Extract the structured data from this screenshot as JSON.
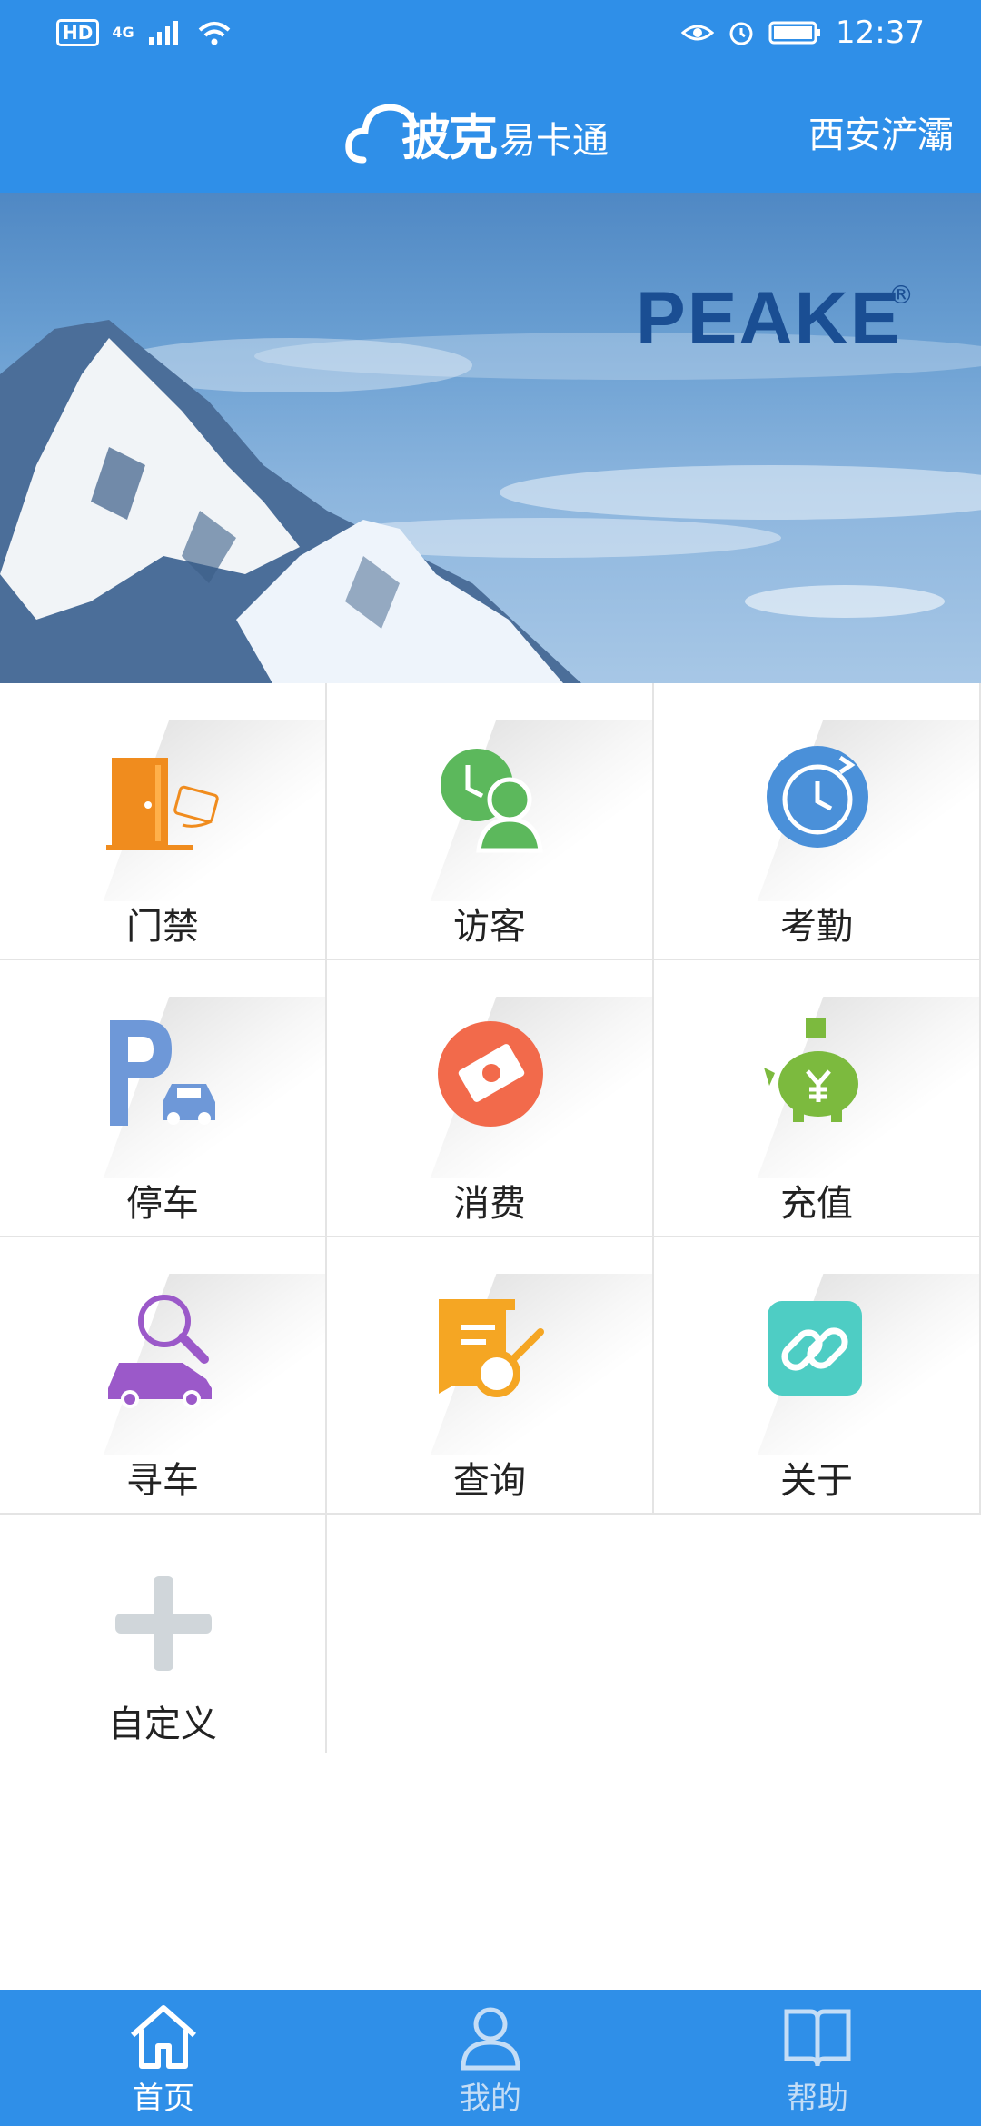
{
  "status_bar": {
    "hd": "HD",
    "network": "4G",
    "time": "12:37"
  },
  "header": {
    "logo_main": "披克",
    "logo_sub": "易卡通",
    "location": "西安浐灞"
  },
  "banner": {
    "brand": "PEAKE",
    "registered": "®"
  },
  "grid": {
    "items": [
      {
        "label": "门禁",
        "icon": "door-card-icon"
      },
      {
        "label": "访客",
        "icon": "visitor-icon"
      },
      {
        "label": "考勤",
        "icon": "attendance-clock-icon"
      },
      {
        "label": "停车",
        "icon": "parking-icon"
      },
      {
        "label": "消费",
        "icon": "payment-icon"
      },
      {
        "label": "充值",
        "icon": "piggy-bank-icon"
      },
      {
        "label": "寻车",
        "icon": "find-car-icon"
      },
      {
        "label": "查询",
        "icon": "query-icon"
      },
      {
        "label": "关于",
        "icon": "link-icon"
      },
      {
        "label": "自定义",
        "icon": "plus-icon"
      }
    ]
  },
  "tabbar": {
    "items": [
      {
        "label": "首页",
        "icon": "home-icon",
        "active": true
      },
      {
        "label": "我的",
        "icon": "user-icon",
        "active": false
      },
      {
        "label": "帮助",
        "icon": "book-icon",
        "active": false
      }
    ]
  },
  "colors": {
    "primary": "#2f8fe8",
    "door": "#f08c1e",
    "visitor": "#5cb85c",
    "attendance": "#4a90d9",
    "parking": "#6e98d8",
    "payment": "#f26a4b",
    "recharge": "#7cba3e",
    "findcar": "#9b59c9",
    "query": "#f5a623",
    "about": "#4ecdc4",
    "custom": "#d0d6da"
  }
}
